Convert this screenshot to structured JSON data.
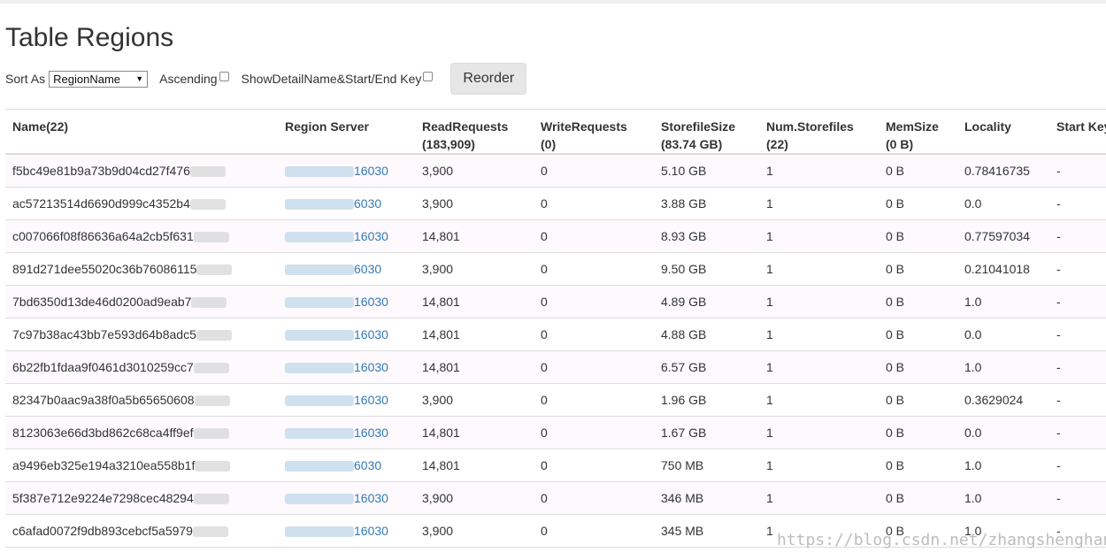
{
  "page": {
    "title": "Table Regions",
    "watermark": "https://blog.csdn.net/zhangshenghang"
  },
  "controls": {
    "sort_label": "Sort As",
    "sort_value": "RegionName",
    "ascending_label": "Ascending",
    "show_detail_label": "ShowDetailName&Start/End Key",
    "reorder_label": "Reorder"
  },
  "table": {
    "headers": [
      {
        "line1": "Name(22)",
        "line2": ""
      },
      {
        "line1": "Region Server",
        "line2": ""
      },
      {
        "line1": "ReadRequests",
        "line2": "(183,909)"
      },
      {
        "line1": "WriteRequests",
        "line2": "(0)"
      },
      {
        "line1": "StorefileSize",
        "line2": "(83.74 GB)"
      },
      {
        "line1": "Num.Storefiles",
        "line2": "(22)"
      },
      {
        "line1": "MemSize",
        "line2": "(0 B)"
      },
      {
        "line1": "Locality",
        "line2": ""
      },
      {
        "line1": "Start Key",
        "line2": ""
      }
    ],
    "rows": [
      {
        "name": "f5bc49e81b9a73b9d04cd27f476",
        "server_port": "16030",
        "read": "3,900",
        "write": "0",
        "size": "5.10 GB",
        "files": "1",
        "mem": "0 B",
        "locality": "0.78416735",
        "start": "-"
      },
      {
        "name": "ac57213514d6690d999c4352b4",
        "server_port": "6030",
        "read": "3,900",
        "write": "0",
        "size": "3.88 GB",
        "files": "1",
        "mem": "0 B",
        "locality": "0.0",
        "start": "-"
      },
      {
        "name": "c007066f08f86636a64a2cb5f631",
        "server_port": "16030",
        "read": "14,801",
        "write": "0",
        "size": "8.93 GB",
        "files": "1",
        "mem": "0 B",
        "locality": "0.77597034",
        "start": "-"
      },
      {
        "name": "891d271dee55020c36b76086115",
        "server_port": "6030",
        "read": "3,900",
        "write": "0",
        "size": "9.50 GB",
        "files": "1",
        "mem": "0 B",
        "locality": "0.21041018",
        "start": "-"
      },
      {
        "name": "7bd6350d13de46d0200ad9eab7",
        "server_port": "16030",
        "read": "14,801",
        "write": "0",
        "size": "4.89 GB",
        "files": "1",
        "mem": "0 B",
        "locality": "1.0",
        "start": "-"
      },
      {
        "name": "7c97b38ac43bb7e593d64b8adc5",
        "server_port": "16030",
        "read": "14,801",
        "write": "0",
        "size": "4.88 GB",
        "files": "1",
        "mem": "0 B",
        "locality": "0.0",
        "start": "-"
      },
      {
        "name": "6b22fb1fdaa9f0461d3010259cc7",
        "server_port": "16030",
        "read": "14,801",
        "write": "0",
        "size": "6.57 GB",
        "files": "1",
        "mem": "0 B",
        "locality": "1.0",
        "start": "-"
      },
      {
        "name": "82347b0aac9a38f0a5b65650608",
        "server_port": "16030",
        "read": "3,900",
        "write": "0",
        "size": "1.96 GB",
        "files": "1",
        "mem": "0 B",
        "locality": "0.3629024",
        "start": "-"
      },
      {
        "name": "8123063e66d3bd862c68ca4ff9ef",
        "server_port": "16030",
        "read": "14,801",
        "write": "0",
        "size": "1.67 GB",
        "files": "1",
        "mem": "0 B",
        "locality": "0.0",
        "start": "-"
      },
      {
        "name": "a9496eb325e194a3210ea558b1f",
        "server_port": "6030",
        "read": "14,801",
        "write": "0",
        "size": "750 MB",
        "files": "1",
        "mem": "0 B",
        "locality": "1.0",
        "start": "-"
      },
      {
        "name": "5f387e712e9224e7298cec48294",
        "server_port": "16030",
        "read": "3,900",
        "write": "0",
        "size": "346 MB",
        "files": "1",
        "mem": "0 B",
        "locality": "1.0",
        "start": "-"
      },
      {
        "name": "c6afad0072f9db893cebcf5a5979",
        "server_port": "16030",
        "read": "3,900",
        "write": "0",
        "size": "345 MB",
        "files": "1",
        "mem": "0 B",
        "locality": "1.0",
        "start": "-"
      }
    ]
  }
}
